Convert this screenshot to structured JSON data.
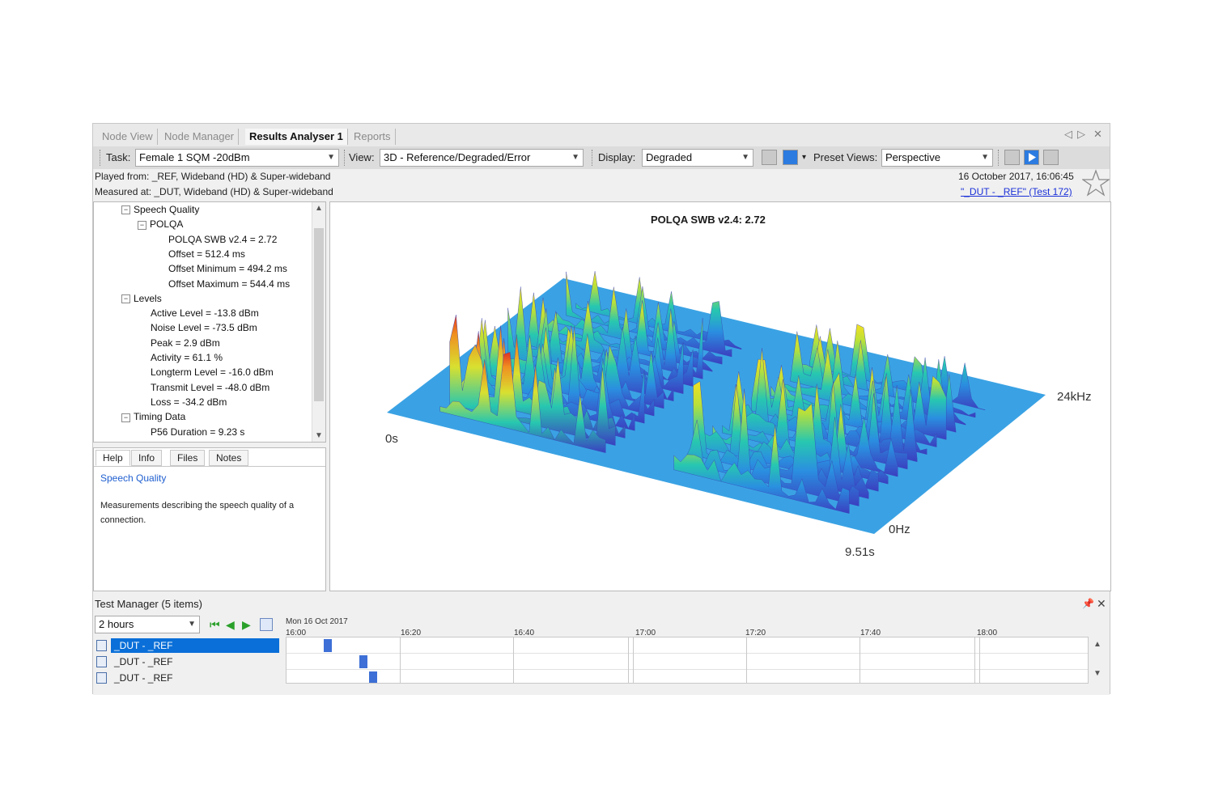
{
  "tabs": {
    "items": [
      "Node View",
      "Node Manager",
      "Results Analyser 1",
      "Reports"
    ],
    "controls": [
      "◁",
      "▷",
      "✕"
    ]
  },
  "toolbar": {
    "task_label": "Task:",
    "task_value": "Female 1 SQM -20dBm",
    "view_label": "View:",
    "view_value": "3D - Reference/Degraded/Error",
    "display_label": "Display:",
    "display_value": "Degraded",
    "preset_label": "Preset Views:",
    "preset_value": "Perspective",
    "dropdown_glyph": "▾"
  },
  "info": {
    "played_from": "Played from: _REF, Wideband (HD) & Super-wideband",
    "measured_at": "Measured at: _DUT, Wideband (HD) & Super-wideband",
    "date": "16 October 2017, 16:06:45",
    "test_link": "\"_DUT - _REF\" (Test 172)"
  },
  "tree": {
    "items": [
      {
        "text": "Speech Quality",
        "toggle": "−"
      },
      {
        "text": "POLQA",
        "toggle": "−"
      },
      {
        "text": "POLQA SWB v2.4 = 2.72"
      },
      {
        "text": "Offset = 512.4 ms"
      },
      {
        "text": "Offset Minimum = 494.2 ms"
      },
      {
        "text": "Offset Maximum = 544.4 ms"
      },
      {
        "text": "Levels",
        "toggle": "−"
      },
      {
        "text": "Active Level = -13.8 dBm"
      },
      {
        "text": "Noise Level = -73.5 dBm"
      },
      {
        "text": "Peak = 2.9 dBm"
      },
      {
        "text": "Activity = 61.1 %"
      },
      {
        "text": "Longterm Level = -16.0 dBm"
      },
      {
        "text": "Transmit Level = -48.0 dBm"
      },
      {
        "text": "Loss = -34.2 dBm"
      },
      {
        "text": "Timing Data",
        "toggle": "−"
      },
      {
        "text": "P56 Duration = 9.23 s"
      }
    ]
  },
  "help": {
    "tabs": [
      "Help",
      "Info",
      "Files",
      "Notes"
    ],
    "title": "Speech Quality",
    "body": "Measurements describing the speech quality of a connection."
  },
  "chart": {
    "title": "POLQA SWB v2.4: 2.72",
    "label_t0": "0s",
    "label_t1": "9.51s",
    "label_f0": "0Hz",
    "label_f1": "24kHz",
    "plane_color": "#3aa2e4"
  },
  "test_manager": {
    "title": "Test Manager (5 items)",
    "range": "2 hours",
    "date": "Mon 16 Oct 2017",
    "times": [
      "16:00",
      "16:20",
      "16:40",
      "17:00",
      "17:20",
      "17:40",
      "18:00"
    ],
    "rows": [
      "_DUT - _REF",
      "_DUT - _REF",
      "_DUT - _REF"
    ]
  }
}
